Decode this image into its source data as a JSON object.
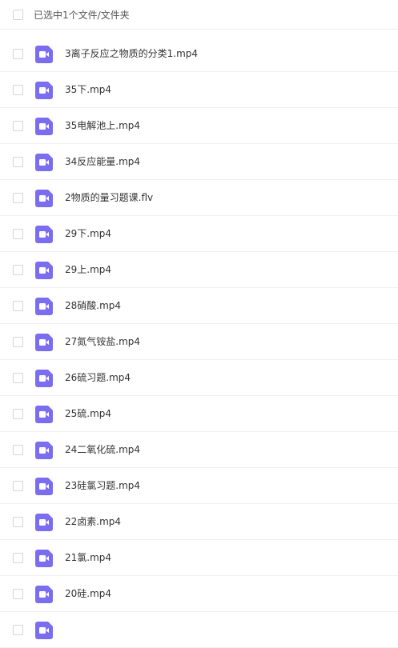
{
  "header": {
    "selection_label": "已选中1个文件/文件夹"
  },
  "files": [
    {
      "name": "3离子反应之物质的分类1.mp4",
      "icon": "video-file-icon"
    },
    {
      "name": "35下.mp4",
      "icon": "video-file-icon"
    },
    {
      "name": "35电解池上.mp4",
      "icon": "video-file-icon"
    },
    {
      "name": "34反应能量.mp4",
      "icon": "video-file-icon"
    },
    {
      "name": "2物质的量习题课.flv",
      "icon": "video-file-icon"
    },
    {
      "name": "29下.mp4",
      "icon": "video-file-icon"
    },
    {
      "name": "29上.mp4",
      "icon": "video-file-icon"
    },
    {
      "name": "28硝酸.mp4",
      "icon": "video-file-icon"
    },
    {
      "name": "27氮气铵盐.mp4",
      "icon": "video-file-icon"
    },
    {
      "name": "26硫习题.mp4",
      "icon": "video-file-icon"
    },
    {
      "name": "25硫.mp4",
      "icon": "video-file-icon"
    },
    {
      "name": "24二氧化硫.mp4",
      "icon": "video-file-icon"
    },
    {
      "name": "23硅氯习题.mp4",
      "icon": "video-file-icon"
    },
    {
      "name": "22卤素.mp4",
      "icon": "video-file-icon"
    },
    {
      "name": "21氯.mp4",
      "icon": "video-file-icon"
    },
    {
      "name": "20硅.mp4",
      "icon": "video-file-icon"
    },
    {
      "name": "",
      "icon": "video-file-icon"
    }
  ],
  "colors": {
    "icon_accent": "#7b6df0",
    "divider": "#f1f1f1",
    "checkbox_border": "#d4d4d4"
  }
}
